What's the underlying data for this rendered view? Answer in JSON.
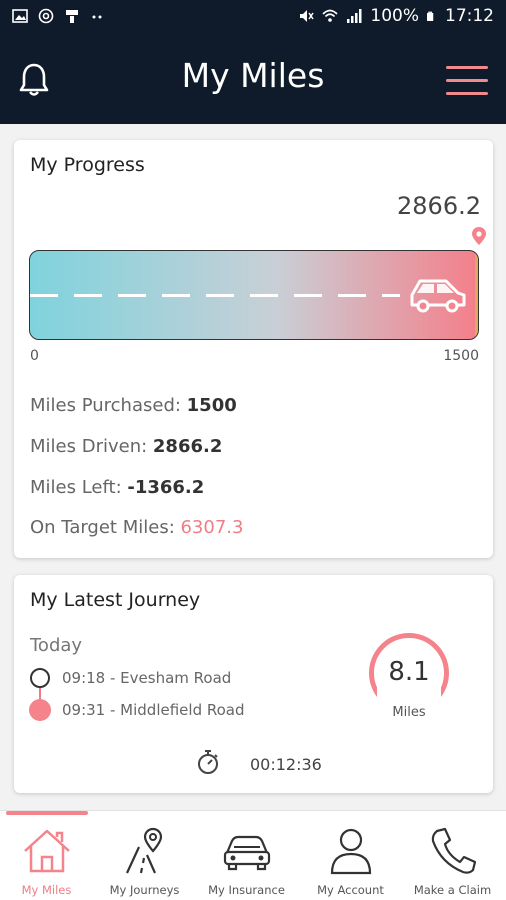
{
  "status_bar": {
    "battery": "100%",
    "time": "17:12"
  },
  "header": {
    "title": "My Miles"
  },
  "progress": {
    "title": "My Progress",
    "total_display": "2866.2",
    "scale_min": "0",
    "scale_max": "1500",
    "fill_fraction": 1.0,
    "stats": [
      {
        "label": "Miles Purchased: ",
        "value": "1500"
      },
      {
        "label": "Miles Driven: ",
        "value": "2866.2"
      },
      {
        "label": "Miles Left: ",
        "value": "-1366.2"
      },
      {
        "label": "On Target Miles: ",
        "value": "6307.3"
      }
    ]
  },
  "journey": {
    "title": "My Latest Journey",
    "day": "Today",
    "start": "09:18 - Evesham Road",
    "end": "09:31 - Middlefield Road",
    "distance": "8.1",
    "distance_unit": "Miles",
    "duration": "00:12:36"
  },
  "tabs": [
    {
      "label": "My Miles",
      "icon": "home-icon",
      "active": true
    },
    {
      "label": "My Journeys",
      "icon": "road-pin-icon",
      "active": false
    },
    {
      "label": "My Insurance",
      "icon": "car-icon",
      "active": false
    },
    {
      "label": "My Account",
      "icon": "user-icon",
      "active": false
    },
    {
      "label": "Make a Claim",
      "icon": "phone-icon",
      "active": false
    }
  ],
  "colors": {
    "header_bg": "#0f1b2b",
    "accent": "#f4838c",
    "gradient_start": "#7fd3dd"
  }
}
